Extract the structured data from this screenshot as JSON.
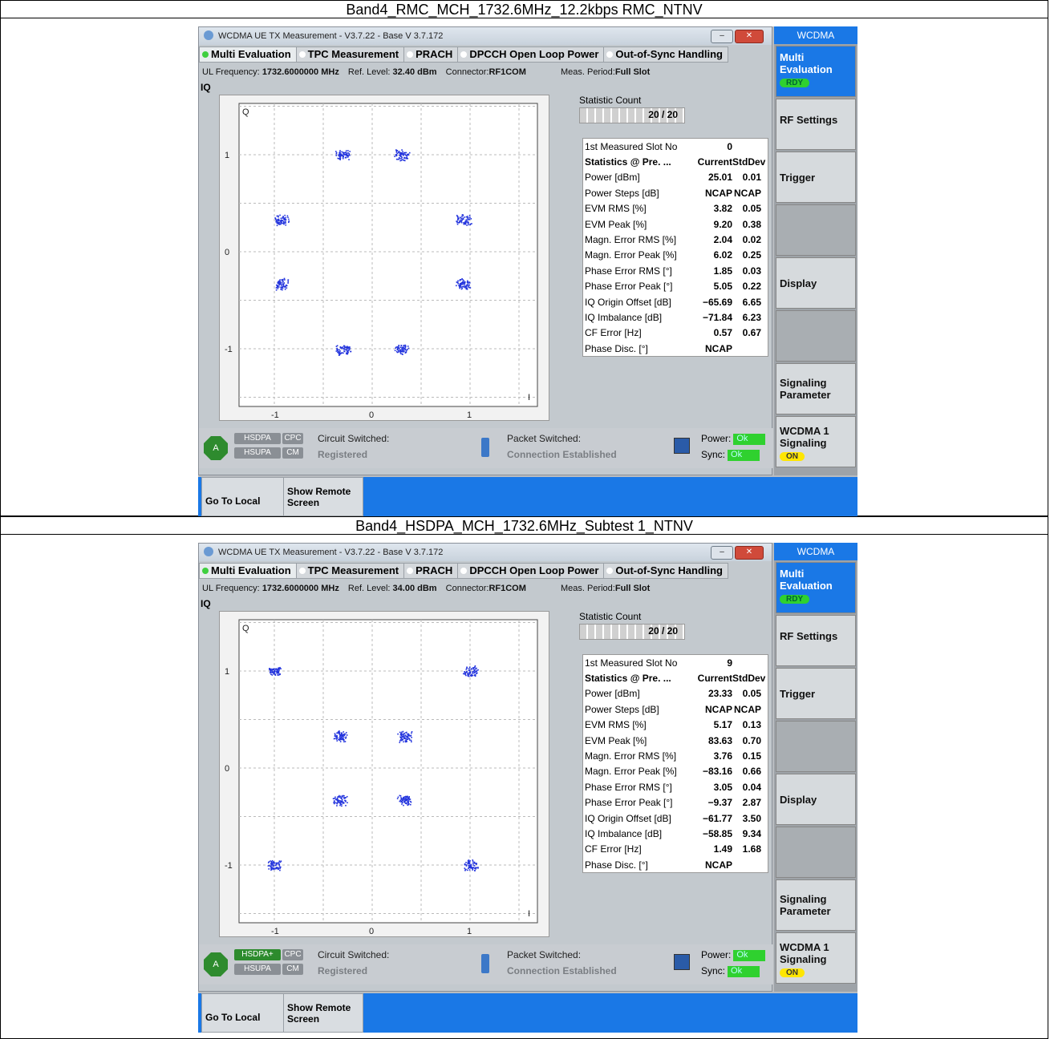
{
  "captions": [
    "Band4_RMC_MCH_1732.6MHz_12.2kbps RMC_NTNV",
    "Band4_HSDPA_MCH_1732.6MHz_Subtest 1_NTNV"
  ],
  "screens": [
    {
      "window_title": "WCDMA UE TX Measurement  - V3.7.22 - Base V 3.7.172",
      "tabs": [
        "Multi Evaluation",
        "TPC Measurement",
        "PRACH",
        "DPCCH Open Loop Power",
        "Out-of-Sync Handling"
      ],
      "ul_frequency_label": "UL Frequency:",
      "ul_frequency_value": "1732.6000000 MHz",
      "ref_level_label": "Ref. Level:",
      "ref_level_value": "32.40 dBm",
      "connector_label": "Connector:",
      "connector_value": "RF1COM",
      "meas_period_label": "Meas. Period:",
      "meas_period_value": "Full Slot",
      "iq_label": "IQ",
      "plot_labels": {
        "q": "Q",
        "i": "I",
        "y": [
          "1",
          "0",
          "-1"
        ],
        "x": [
          "-1",
          "0",
          "1"
        ]
      },
      "constellation": "qpsk8",
      "statistic_count_label": "Statistic Count",
      "statistic_count_value": "20 / 20",
      "statistic_fraction": 1.0,
      "stats": [
        {
          "label": "1st Measured Slot No",
          "v1": "0",
          "v2": ""
        },
        {
          "label": "Statistics @ Pre. ...",
          "v1": "Current",
          "v2": "StdDev",
          "bold": true
        },
        {
          "label": "Power [dBm]",
          "v1": "25.01",
          "v2": "0.01"
        },
        {
          "label": "Power Steps [dB]",
          "v1": "NCAP",
          "v2": "NCAP"
        },
        {
          "label": "EVM RMS [%]",
          "v1": "3.82",
          "v2": "0.05"
        },
        {
          "label": "EVM Peak [%]",
          "v1": "9.20",
          "v2": "0.38"
        },
        {
          "label": "Magn. Error RMS [%]",
          "v1": "2.04",
          "v2": "0.02"
        },
        {
          "label": "Magn. Error Peak [%]",
          "v1": "6.02",
          "v2": "0.25"
        },
        {
          "label": "Phase Error RMS [°]",
          "v1": "1.85",
          "v2": "0.03"
        },
        {
          "label": "Phase Error Peak [°]",
          "v1": "5.05",
          "v2": "0.22"
        },
        {
          "label": "IQ Origin Offset [dB]",
          "v1": "−65.69",
          "v2": "6.65"
        },
        {
          "label": "IQ Imbalance [dB]",
          "v1": "−71.84",
          "v2": "6.23"
        },
        {
          "label": "CF Error [Hz]",
          "v1": "0.57",
          "v2": "0.67"
        },
        {
          "label": "Phase Disc. [°]",
          "v1": "NCAP",
          "v2": ""
        }
      ],
      "status": {
        "hsdpa": "HSDPA",
        "cpc": "CPC",
        "hsupa": "HSUPA",
        "cm": "CM",
        "circuit_switched": "Circuit Switched:",
        "cs_state": "Registered",
        "packet_switched": "Packet Switched:",
        "ps_state": "Connection Established",
        "power_label": "Power:",
        "power_state": "Ok",
        "sync_label": "Sync:",
        "sync_state": "Ok"
      },
      "bottom_buttons": [
        "Go To Local",
        "Show Remote Screen"
      ],
      "sidebar": {
        "header": "WCDMA",
        "multi_eval": "Multi Evaluation",
        "rdy": "RDY",
        "rf_settings": "RF Settings",
        "trigger": "Trigger",
        "display": "Display",
        "signaling_param": "Signaling Parameter",
        "wcdma1": "WCDMA 1 Signaling",
        "on": "ON"
      },
      "colors": {
        "accent": "#1a78e6",
        "ok": "#2fd12f",
        "points": "#2233dd"
      }
    },
    {
      "window_title": "WCDMA UE TX Measurement  - V3.7.22 - Base V 3.7.172",
      "tabs": [
        "Multi Evaluation",
        "TPC Measurement",
        "PRACH",
        "DPCCH Open Loop Power",
        "Out-of-Sync Handling"
      ],
      "ul_frequency_label": "UL Frequency:",
      "ul_frequency_value": "1732.6000000 MHz",
      "ref_level_label": "Ref. Level:",
      "ref_level_value": "34.00 dBm",
      "connector_label": "Connector:",
      "connector_value": "RF1COM",
      "meas_period_label": "Meas. Period:",
      "meas_period_value": "Full Slot",
      "iq_label": "IQ",
      "plot_labels": {
        "q": "Q",
        "i": "I",
        "y": [
          "1",
          "0",
          "-1"
        ],
        "x": [
          "-1",
          "0",
          "1"
        ]
      },
      "constellation": "qam8",
      "statistic_count_label": "Statistic Count",
      "statistic_count_value": "20 / 20",
      "statistic_fraction": 1.0,
      "stats": [
        {
          "label": "1st Measured Slot No",
          "v1": "9",
          "v2": ""
        },
        {
          "label": "Statistics @ Pre. ...",
          "v1": "Current",
          "v2": "StdDev",
          "bold": true
        },
        {
          "label": "Power [dBm]",
          "v1": "23.33",
          "v2": "0.05"
        },
        {
          "label": "Power Steps [dB]",
          "v1": "NCAP",
          "v2": "NCAP"
        },
        {
          "label": "EVM RMS [%]",
          "v1": "5.17",
          "v2": "0.13"
        },
        {
          "label": "EVM Peak [%]",
          "v1": "83.63",
          "v2": "0.70"
        },
        {
          "label": "Magn. Error RMS [%]",
          "v1": "3.76",
          "v2": "0.15"
        },
        {
          "label": "Magn. Error Peak [%]",
          "v1": "−83.16",
          "v2": "0.66"
        },
        {
          "label": "Phase Error RMS [°]",
          "v1": "3.05",
          "v2": "0.04"
        },
        {
          "label": "Phase Error Peak [°]",
          "v1": "−9.37",
          "v2": "2.87"
        },
        {
          "label": "IQ Origin Offset [dB]",
          "v1": "−61.77",
          "v2": "3.50"
        },
        {
          "label": "IQ Imbalance [dB]",
          "v1": "−58.85",
          "v2": "9.34"
        },
        {
          "label": "CF Error [Hz]",
          "v1": "1.49",
          "v2": "1.68"
        },
        {
          "label": "Phase Disc. [°]",
          "v1": "NCAP",
          "v2": ""
        }
      ],
      "status": {
        "hsdpa": "HSDPA+",
        "cpc": "CPC",
        "hsupa": "HSUPA",
        "cm": "CM",
        "circuit_switched": "Circuit Switched:",
        "cs_state": "Registered",
        "packet_switched": "Packet Switched:",
        "ps_state": "Connection Established",
        "power_label": "Power:",
        "power_state": "Ok",
        "sync_label": "Sync:",
        "sync_state": "Ok"
      },
      "bottom_buttons": [
        "Go To Local",
        "Show Remote Screen"
      ],
      "sidebar": {
        "header": "WCDMA",
        "multi_eval": "Multi Evaluation",
        "rdy": "RDY",
        "rf_settings": "RF Settings",
        "trigger": "Trigger",
        "display": "Display",
        "signaling_param": "Signaling Parameter",
        "wcdma1": "WCDMA 1 Signaling",
        "on": "ON"
      },
      "colors": {
        "accent": "#1a78e6",
        "ok": "#2fd12f",
        "points": "#2233dd"
      }
    }
  ]
}
